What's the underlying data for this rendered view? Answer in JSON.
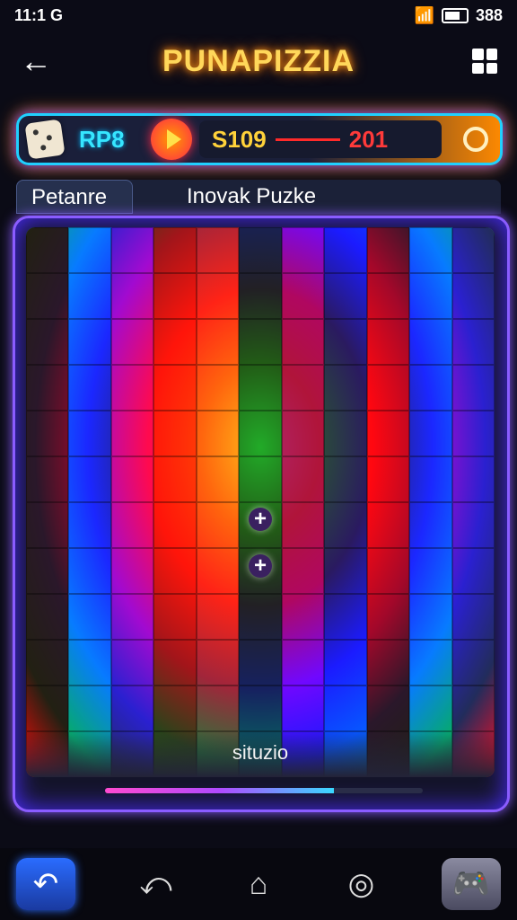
{
  "status": {
    "time": "11:1 G",
    "battery": "388"
  },
  "header": {
    "title": "PUNAPIZZIA"
  },
  "scorebar": {
    "rp_label": "RP8",
    "score": "S109",
    "target": "201"
  },
  "tabs": [
    {
      "label": "Petanre"
    },
    {
      "label": "Inovak Puzke"
    }
  ],
  "board": {
    "caption": "situzio",
    "progress_fraction": 0.72
  },
  "icons": {
    "back": "arrow-left-icon",
    "menu": "grid-menu-icon",
    "dice": "dice-icon",
    "play": "play-icon",
    "ring": "ring-icon",
    "undo": "undo-icon",
    "nav_back": "nav-back-icon",
    "home": "home-icon",
    "settings": "target-settings-icon",
    "controller": "controller-icon"
  }
}
